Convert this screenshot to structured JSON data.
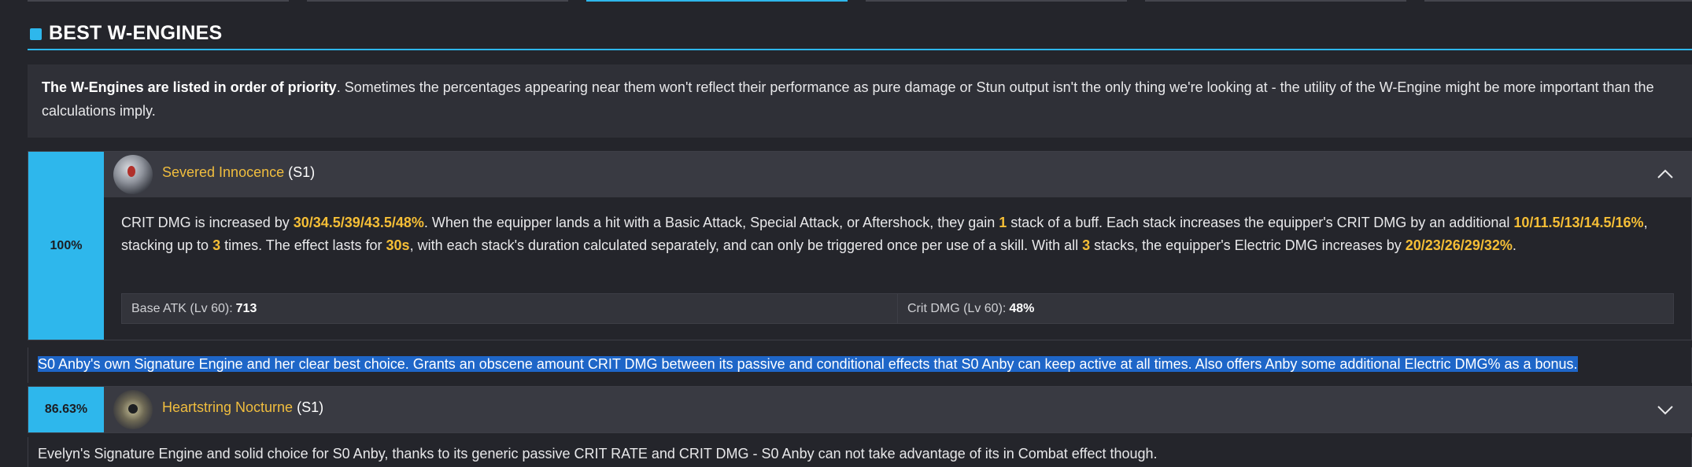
{
  "section": {
    "title": "BEST W-ENGINES"
  },
  "intro": {
    "bold": "The W-Engines are listed in order of priority",
    "rest": ". Sometimes the percentages appearing near them won't reflect their performance as pure damage or Stun output isn't the only thing we're looking at - the utility of the W-Engine might be more important than the calculations imply."
  },
  "engines": [
    {
      "percent": "100%",
      "name": "Severed Innocence",
      "rank": "(S1)",
      "expanded": true,
      "icon": "helmet-icon",
      "desc": {
        "t1": "CRIT DMG is increased by ",
        "h1": "30/34.5/39/43.5/48%",
        "t2": ". When the equipper lands a hit with a Basic Attack, Special Attack, or Aftershock, they gain ",
        "h2": "1",
        "t3": " stack of a buff. Each stack increases the equipper's CRIT DMG by an additional ",
        "h3": "10/11.5/13/14.5/16%",
        "t4": ", stacking up to ",
        "h4": "3",
        "t5": " times. The effect lasts for ",
        "h5": "30s",
        "t6": ", with each stack's duration calculated separately, and can only be triggered once per use of a skill. With all ",
        "h6": "3",
        "t7": " stacks, the equipper's Electric DMG increases by ",
        "h7": "20/23/26/29/32%",
        "t8": "."
      },
      "stats": [
        {
          "label": "Base ATK (Lv 60):",
          "value": "713"
        },
        {
          "label": "Crit DMG (Lv 60):",
          "value": "48%"
        }
      ],
      "note": "S0 Anby's own Signature Engine and her clear best choice. Grants an obscene amount CRIT DMG between its passive and conditional effects that S0 Anby can keep active at all times. Also offers Anby some additional Electric DMG% as a bonus."
    },
    {
      "percent": "86.63%",
      "name": "Heartstring Nocturne",
      "rank": "(S1)",
      "expanded": false,
      "icon": "amplifier-icon",
      "note": "Evelyn's Signature Engine and solid choice for S0 Anby, thanks to its generic passive CRIT RATE and CRIT DMG - S0 Anby can not take advantage of its in Combat effect though."
    }
  ],
  "colors": {
    "accent": "#2eb7ec",
    "highlight": "#f5be36",
    "name": "#f0bd3e",
    "selection": "#1e66c8"
  }
}
